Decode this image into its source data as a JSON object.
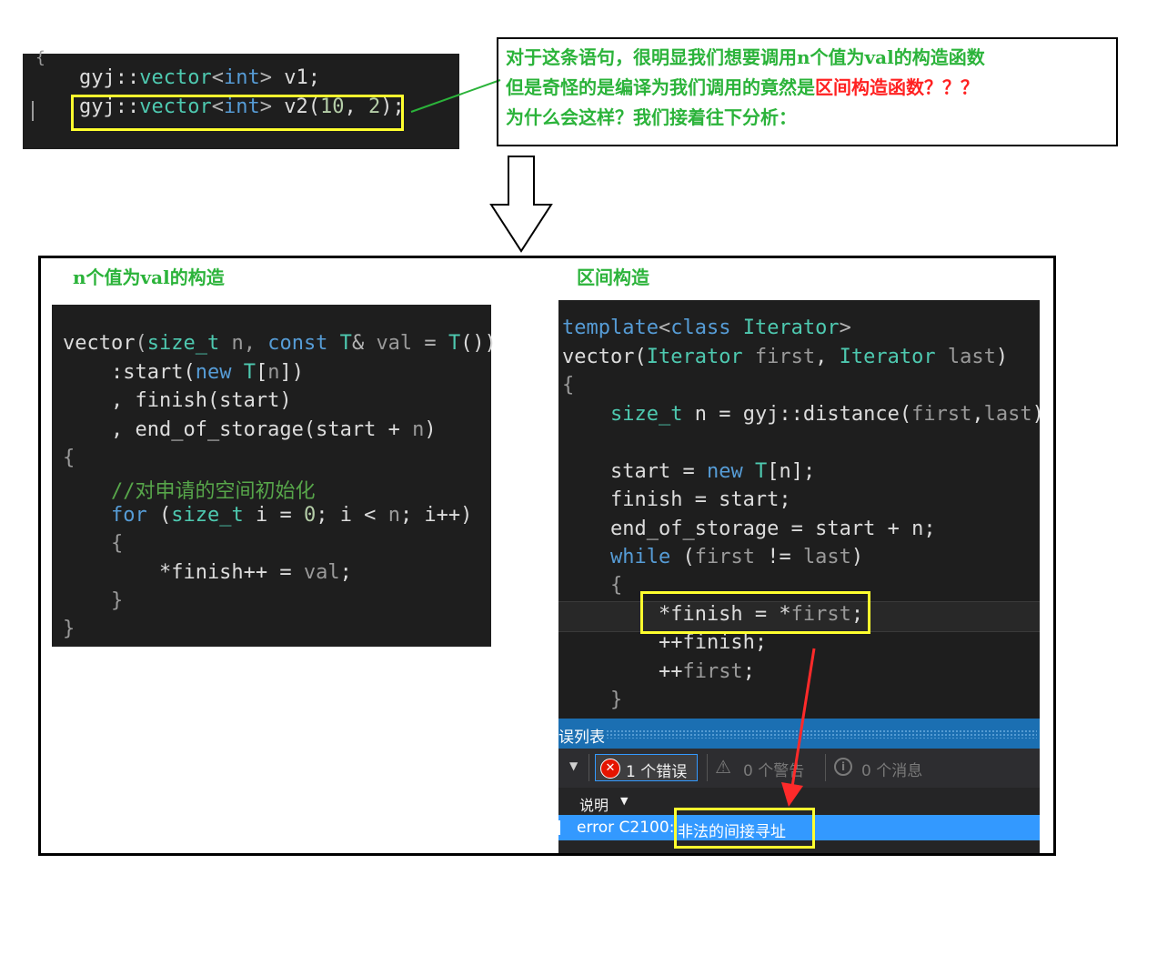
{
  "top_code": {
    "line1": {
      "ns": "gyj::",
      "type": "vector",
      "lt": "<",
      "kw": "int",
      "gt": ">",
      "rest": " v1;"
    },
    "line2": {
      "ns": "gyj::",
      "type": "vector",
      "lt": "<",
      "kw": "int",
      "gt": ">",
      "name": " v2",
      "open": "(",
      "a": "10",
      "comma": ", ",
      "b": "2",
      "close": ");"
    }
  },
  "note": {
    "line1": "对于这条语句，很明显我们想要调用n个值为val的构造函数",
    "line2_prefix": "但是奇怪的是编译为我们调用的竟然是",
    "line2_red": "区间构造函数？？？",
    "line3": "为什么会这样？我们接着往下分析："
  },
  "headings": {
    "left": "n个值为val的构造",
    "right": "区间构造"
  },
  "left_code": {
    "l1a": "vector",
    "l1b": "(",
    "l1c": "size_t",
    "l1d": " n, ",
    "l1e": "const",
    "l1f": " T",
    "l1g": "& ",
    "l1h": "val",
    "l1i": " = ",
    "l1j": "T",
    "l1k": "())",
    "l2a": "    :start(",
    "l2b": "new",
    "l2c": " T",
    "l2d": "[",
    "l2e": "n",
    "l2f": "])",
    "l3": "    , finish(start)",
    "l4a": "    , end_of_storage(start + ",
    "l4b": "n",
    "l4c": ")",
    "l5": "{",
    "l6": "    //对申请的空间初始化",
    "l7a": "    ",
    "l7b": "for",
    "l7c": " (",
    "l7d": "size_t",
    "l7e": " i = ",
    "l7f": "0",
    "l7g": "; i < ",
    "l7h": "n",
    "l7i": "; i++)",
    "l8": "    {",
    "l9a": "        *finish++ = ",
    "l9b": "val",
    "l9c": ";",
    "l10": "    }",
    "l11": "}"
  },
  "right_code": {
    "l1a": "template",
    "l1b": "<",
    "l1c": "class",
    "l1d": " Iterator",
    "l1e": ">",
    "l2a": "vector(",
    "l2b": "Iterator",
    "l2c": " first",
    "l2d": ", ",
    "l2e": "Iterator",
    "l2f": " last",
    "l2g": ")",
    "l3": "{",
    "l4a": "    ",
    "l4b": "size_t",
    "l4c": " n = gyj::distance(",
    "l4d": "first",
    "l4e": ",",
    "l4f": "last",
    "l4g": ");",
    "l6a": "    start = ",
    "l6b": "new",
    "l6c": " T",
    "l6d": "[n];",
    "l7": "    finish = start;",
    "l8": "    end_of_storage = start + n;",
    "l9a": "    ",
    "l9b": "while",
    "l9c": " (",
    "l9d": "first",
    "l9e": " != ",
    "l9f": "last",
    "l9g": ")",
    "l10": "    {",
    "l11a": "        *finish = *",
    "l11b": "first",
    "l11c": ";",
    "l12": "        ++finish;",
    "l13a": "        ++",
    "l13b": "first",
    "l13c": ";",
    "l14": "    }"
  },
  "error_list": {
    "title": "误列表",
    "errors_label": "1 个错误",
    "warnings_label": "0 个警告",
    "messages_label": "0 个消息",
    "column_description": "说明",
    "row_code": "error C2100:",
    "row_message": "非法的间接寻址"
  }
}
